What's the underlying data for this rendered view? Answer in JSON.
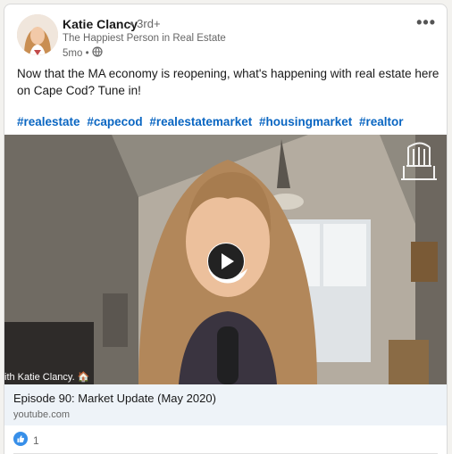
{
  "post": {
    "author": {
      "name": "Katie Clancy",
      "degree": "• 3rd+",
      "headline": "The Happiest Person in Real Estate",
      "time": "5mo •"
    },
    "text": "Now that the MA economy is reopening, what's happening with real estate here on Cape Cod? Tune in!",
    "hashtags": [
      "#realestate",
      "#capecod",
      "#realestatemarket",
      "#housingmarket",
      "#realtor"
    ],
    "video": {
      "caption": "ith Katie Clancy. 🏠"
    },
    "link": {
      "title": "Episode 90: Market Update (May 2020)",
      "domain": "youtube.com"
    },
    "reactions": {
      "count": "1"
    }
  },
  "colors": {
    "accent": "#0a66c2",
    "background": "#f3f2ef"
  }
}
